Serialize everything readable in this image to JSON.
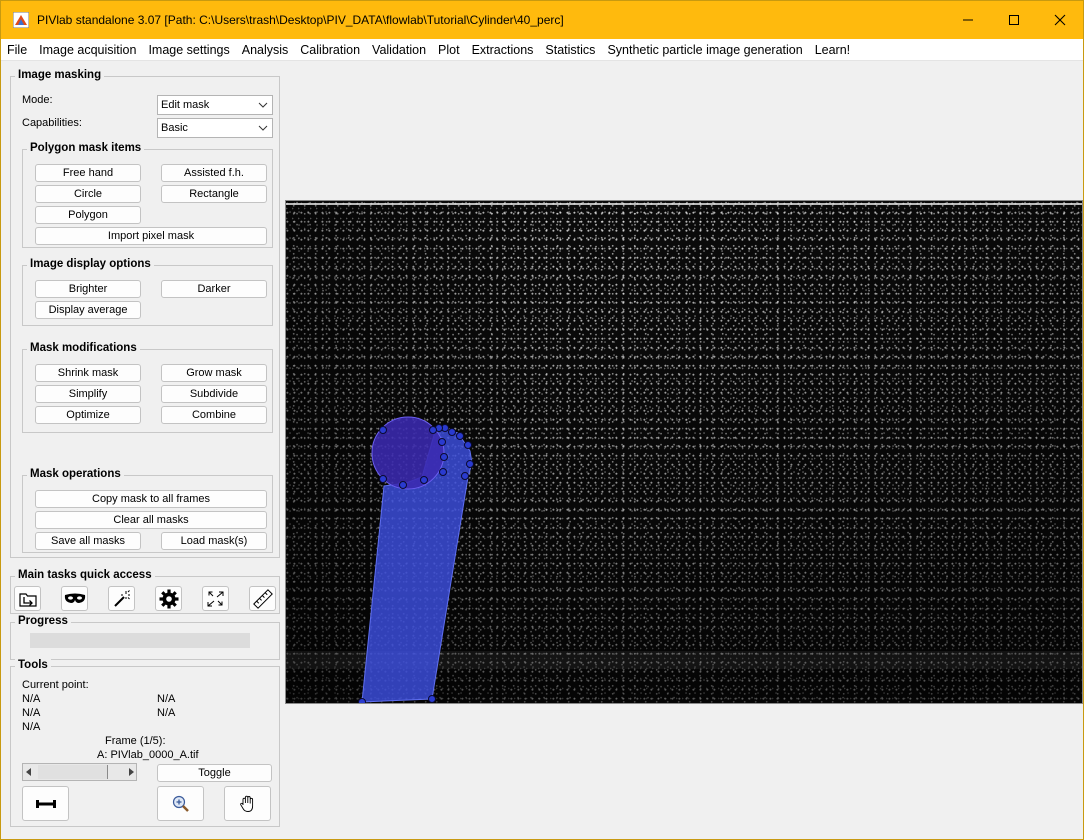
{
  "window": {
    "title": "PIVlab standalone 3.07   [Path: C:\\Users\\trash\\Desktop\\PIV_DATA\\flowlab\\Tutorial\\Cylinder\\40_perc]"
  },
  "menu": [
    "File",
    "Image acquisition",
    "Image settings",
    "Analysis",
    "Calibration",
    "Validation",
    "Plot",
    "Extractions",
    "Statistics",
    "Synthetic particle image generation",
    "Learn!"
  ],
  "image_masking": {
    "title": "Image masking",
    "mode_label": "Mode:",
    "mode_value": "Edit mask",
    "capabilities_label": "Capabilities:",
    "capabilities_value": "Basic"
  },
  "polygon_mask_items": {
    "title": "Polygon mask items",
    "free_hand": "Free hand",
    "assisted": "Assisted f.h.",
    "circle": "Circle",
    "rectangle": "Rectangle",
    "polygon": "Polygon",
    "import_pixel_mask": "Import pixel mask"
  },
  "image_display_options": {
    "title": "Image display options",
    "brighter": "Brighter",
    "darker": "Darker",
    "display_average": "Display average"
  },
  "mask_modifications": {
    "title": "Mask modifications",
    "shrink": "Shrink mask",
    "grow": "Grow mask",
    "simplify": "Simplify",
    "subdivide": "Subdivide",
    "optimize": "Optimize",
    "combine": "Combine"
  },
  "mask_operations": {
    "title": "Mask operations",
    "copy_all": "Copy mask to all frames",
    "clear_all": "Clear all masks",
    "save_all": "Save all masks",
    "load": "Load mask(s)"
  },
  "quick_access": {
    "title": "Main tasks quick access",
    "icons": [
      "load-images-icon",
      "mask-icon",
      "magic-wand-icon",
      "gear-icon",
      "expand-arrows-icon",
      "ruler-icon"
    ]
  },
  "progress": {
    "title": "Progress",
    "value": 0
  },
  "tools": {
    "title": "Tools",
    "current_point_label": "Current point:",
    "values_left": [
      "N/A",
      "N/A",
      "N/A"
    ],
    "values_right": [
      "N/A",
      "N/A"
    ],
    "frame_label": "Frame (1/5):",
    "frame_file": "A: PIVlab_0000_A.tif",
    "toggle": "Toggle"
  },
  "colors": {
    "titlebar": "#ffba0d",
    "mask_fill": "#3d4fe0",
    "mask_circle": "#3b2ab0",
    "panel_bg": "#f0f0f0"
  }
}
